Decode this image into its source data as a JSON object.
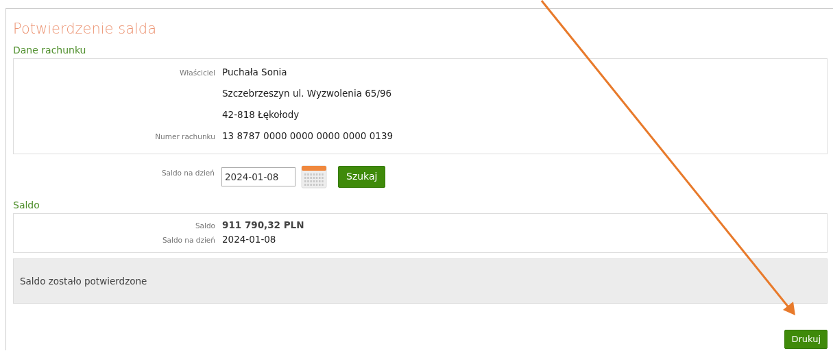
{
  "title": "Potwierdzenie salda",
  "account_section": {
    "heading": "Dane rachunku",
    "rows": [
      {
        "label": "Właściciel",
        "value": "Puchała Sonia"
      },
      {
        "value": "Szczebrzeszyn ul. Wyzwolenia 65/96"
      },
      {
        "value": "42-818 Łękołody"
      },
      {
        "label": "Numer rachunku",
        "value": "13 8787 0000 0000 0000 0000 0139"
      }
    ]
  },
  "search": {
    "label": "Saldo na dzień",
    "date": "2024-01-08",
    "button": "Szukaj"
  },
  "balance_section": {
    "heading": "Saldo",
    "rows": [
      {
        "label": "Saldo",
        "value": "911 790,32 PLN",
        "bold": true
      },
      {
        "label": "Saldo na dzień",
        "value": "2024-01-08",
        "bold": false
      }
    ]
  },
  "message": "Saldo zostało potwierdzone",
  "print_button": "Drukuj"
}
